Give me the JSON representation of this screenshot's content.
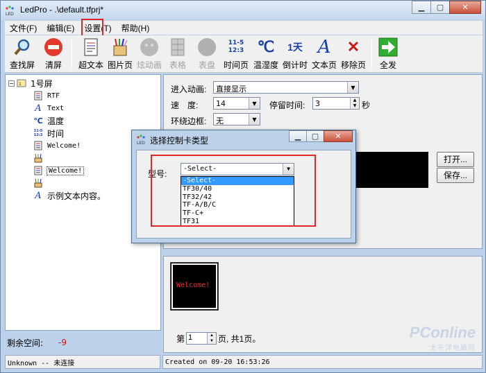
{
  "window": {
    "title": "LedPro - .\\default.tfprj*"
  },
  "menu": [
    "文件(F)",
    "编辑(E)",
    "设置(T)",
    "帮助(H)"
  ],
  "toolbar": [
    {
      "label": "查找屏",
      "icon": "magnifier-icon",
      "enabled": true
    },
    {
      "label": "清屏",
      "icon": "no-entry-icon",
      "enabled": true
    },
    {
      "label": "超文本",
      "icon": "document-icon",
      "enabled": true
    },
    {
      "label": "图片页",
      "icon": "paintbrush-icon",
      "enabled": true
    },
    {
      "label": "炫动画",
      "icon": "animation-icon",
      "enabled": false
    },
    {
      "label": "表格",
      "icon": "table-icon",
      "enabled": false
    },
    {
      "label": "表盘",
      "icon": "clock-dial-icon",
      "enabled": false
    },
    {
      "label": "时间页",
      "icon": "date-icon",
      "enabled": true,
      "glyph": "11-5\n12:3"
    },
    {
      "label": "温湿度",
      "icon": "celsius-icon",
      "enabled": true,
      "glyph": "℃"
    },
    {
      "label": "倒计时",
      "icon": "countdown-icon",
      "enabled": true,
      "glyph": "1天"
    },
    {
      "label": "文本页",
      "icon": "text-a-icon",
      "enabled": true,
      "glyph": "A"
    },
    {
      "label": "移除页",
      "icon": "remove-x-icon",
      "enabled": true,
      "glyph": "✕"
    },
    {
      "label": "全发",
      "icon": "send-all-arrow-icon",
      "enabled": true
    }
  ],
  "tree": {
    "root": "1号屏",
    "items": [
      {
        "label": "RTF",
        "icon": "rtf-doc-icon",
        "mono": true
      },
      {
        "label": "Text",
        "icon": "text-a-icon",
        "mono": true
      },
      {
        "label": "温度",
        "icon": "celsius-icon",
        "mono": false
      },
      {
        "label": "时间",
        "icon": "date-icon",
        "mono": false
      },
      {
        "label": "Welcome!",
        "icon": "image-page-icon",
        "mono": true
      },
      {
        "label": "",
        "icon": "paintbrush-icon",
        "mono": false
      },
      {
        "label": "Welcome!",
        "icon": "rtf-doc-icon",
        "mono": true,
        "selected": true
      },
      {
        "label": "",
        "icon": "paintbrush-icon",
        "mono": false
      },
      {
        "label": "示例文本内容。",
        "icon": "text-a-icon",
        "mono": false
      }
    ]
  },
  "left_status": {
    "label": "剩余空间:",
    "value": "-9"
  },
  "props": {
    "entry_anim_label": "进入动画:",
    "entry_anim_value": "直接显示",
    "speed_label": "速　度:",
    "speed_value": "14",
    "stay_label": "停留时间:",
    "stay_value": "3",
    "stay_unit": "秒",
    "border_label": "环绕边框:",
    "border_value": "无",
    "open_btn": "打开...",
    "save_btn": "保存..."
  },
  "preview": {
    "thumb_text": "Welcome!",
    "page_prefix": "第",
    "page_value": "1",
    "page_suffix": "页, 共1页。"
  },
  "statusbar": {
    "left": "Unknown -- 未连接",
    "right": "Created on 09-20 16:53:26"
  },
  "dialog": {
    "title": "选择控制卡类型",
    "model_label": "型号:",
    "selected": "-Select-",
    "options": [
      "-Select-",
      "TF30/40",
      "TF32/42",
      "TF-A/B/C",
      "TF-C+",
      "TF31"
    ]
  },
  "watermark": {
    "line1": "PConline",
    "line2": "太平洋电脑网"
  },
  "colors": {
    "highlight_red": "#e02626",
    "selection_blue": "#3399ff",
    "frame_blue": "#bcd2ea"
  }
}
